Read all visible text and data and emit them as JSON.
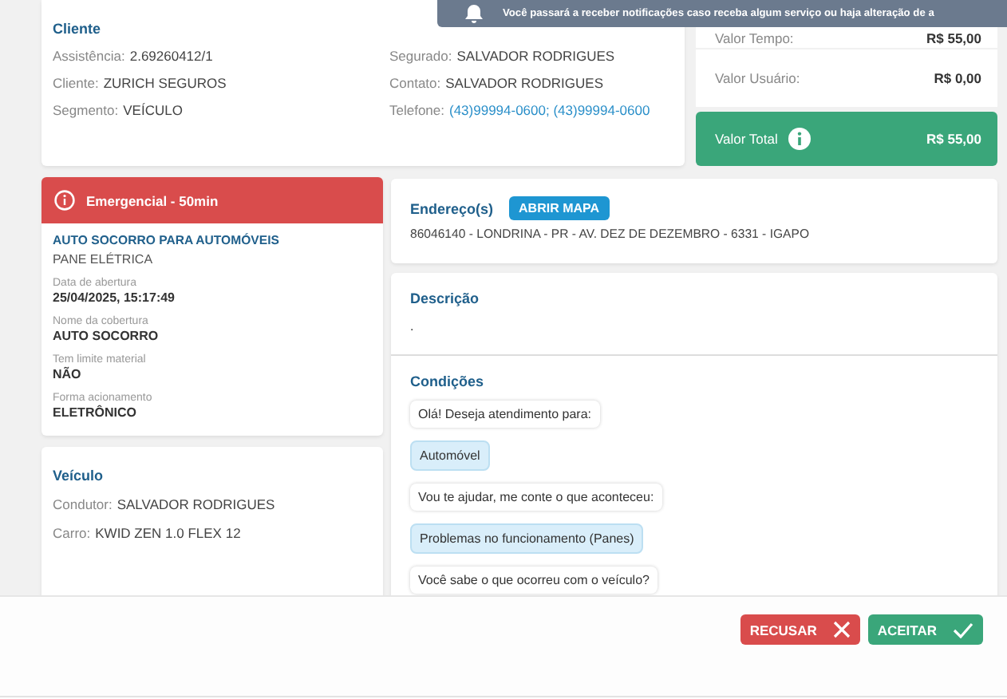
{
  "toast": {
    "text": "Você passará a receber notificações caso receba algum serviço ou haja alteração de a"
  },
  "client": {
    "title": "Cliente",
    "fields": [
      {
        "label": "Assistência:",
        "value": "2.69260412/1",
        "kind": "plain"
      },
      {
        "label": "Segurado:",
        "value": "SALVADOR RODRIGUES",
        "kind": "plain"
      },
      {
        "label": "Cliente:",
        "value": "ZURICH SEGUROS",
        "kind": "plain"
      },
      {
        "label": "Contato:",
        "value": "SALVADOR RODRIGUES",
        "kind": "plain"
      },
      {
        "label": "Segmento:",
        "value": "VEÍCULO",
        "kind": "plain"
      },
      {
        "label": "Telefone:",
        "value": "(43)99994-0600; (43)99994-0600",
        "kind": "link"
      }
    ]
  },
  "values": [
    {
      "label": "Valor Tempo:",
      "amount": "R$ 55,00",
      "kind": "row"
    },
    {
      "label": "Valor Usuário:",
      "amount": "R$ 0,00",
      "kind": "row"
    },
    {
      "label": "Valor Total",
      "amount": "R$ 55,00",
      "kind": "total"
    }
  ],
  "service": {
    "urgency": "Emergencial - 50min",
    "title": "AUTO SOCORRO PARA AUTOMÓVEIS",
    "subtitle": "PANE ELÉTRICA",
    "details": [
      {
        "label": "Data de abertura",
        "value": "25/04/2025, 15:17:49"
      },
      {
        "label": "Nome da cobertura",
        "value": "AUTO SOCORRO"
      },
      {
        "label": "Tem limite material",
        "value": "NÃO"
      },
      {
        "label": "Forma acionamento",
        "value": "ELETRÔNICO"
      }
    ]
  },
  "vehicle": {
    "title": "Veículo",
    "fields": [
      {
        "label": "Condutor:",
        "value": "SALVADOR RODRIGUES"
      },
      {
        "label": "Carro:",
        "value": "KWID ZEN 1.0 FLEX 12"
      }
    ]
  },
  "address": {
    "title": "Endereço(s)",
    "button": "ABRIR MAPA",
    "text": "86046140 - LONDRINA - PR - AV. DEZ DE DEZEMBRO - 6331 - IGAPO"
  },
  "description": {
    "title": "Descrição",
    "text": "."
  },
  "conditions": {
    "title": "Condições",
    "messages": [
      {
        "text": "Olá! Deseja atendimento para:",
        "kind": "question"
      },
      {
        "text": "Automóvel",
        "kind": "answer"
      },
      {
        "text": "Vou te ajudar, me conte o que aconteceu:",
        "kind": "question"
      },
      {
        "text": "Problemas no funcionamento (Panes)",
        "kind": "answer"
      },
      {
        "text": "Você sabe o que ocorreu com o veículo?",
        "kind": "question"
      }
    ]
  },
  "actions": [
    {
      "label": "RECUSAR",
      "kind": "reject"
    },
    {
      "label": "ACEITAR",
      "kind": "accept"
    }
  ]
}
